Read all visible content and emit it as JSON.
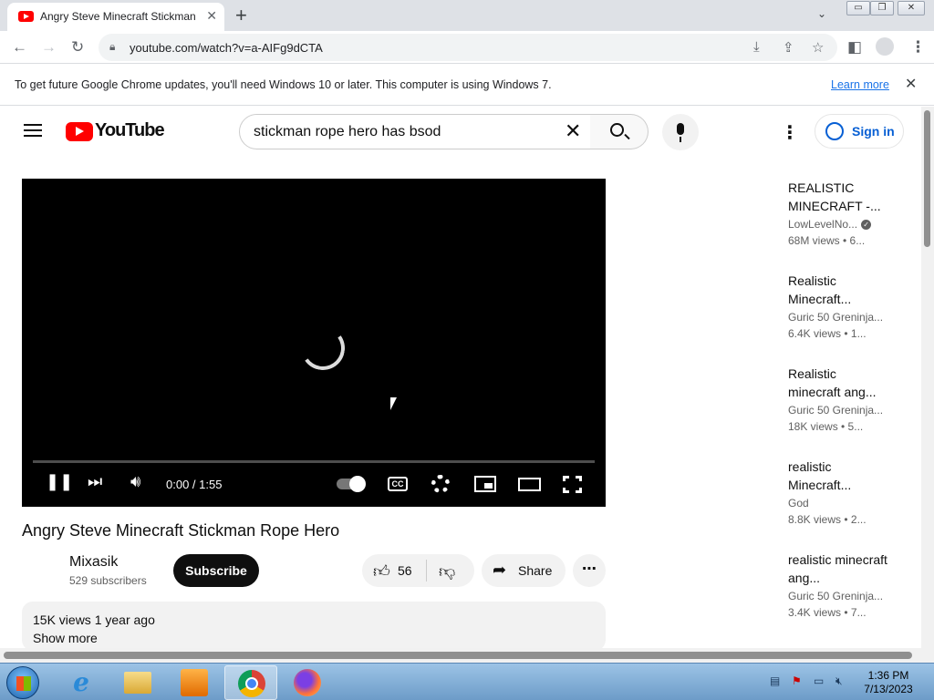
{
  "browser": {
    "tab_title": "Angry Steve Minecraft Stickman",
    "tab_close": "✕",
    "new_tab": "+",
    "tab_search": "⌄",
    "window_controls": [
      "▭",
      "❐",
      "✕"
    ],
    "url": "youtube.com/watch?v=a-AIFg9dCTA",
    "infobar_message": "To get future Google Chrome updates, you'll need Windows 10 or later. This computer is using Windows 7.",
    "infobar_link": "Learn more",
    "infobar_close": "✕"
  },
  "youtube": {
    "logo_text": "YouTube",
    "search_query": "stickman rope hero has bsod",
    "sign_in": "Sign in",
    "more_menu": "⋮"
  },
  "player": {
    "time": "0:00 / 1:55",
    "cc_label": "CC",
    "progress": 0
  },
  "video": {
    "title": "Angry Steve Minecraft Stickman Rope Hero",
    "channel": "Mixasik",
    "subscribers": "529 subscribers",
    "subscribe_label": "Subscribe",
    "likes": "56",
    "share_label": "Share",
    "meta": "15K views  1 year ago",
    "show_more": "Show more"
  },
  "recommendations": [
    {
      "title": "REALISTIC MINECRAFT -...",
      "channel": "LowLevelNo...",
      "verified": true,
      "stats": "68M views  • 6..."
    },
    {
      "title": "Realistic Minecraft...",
      "channel": "Guric 50 Greninja...",
      "verified": false,
      "stats": "6.4K views  • 1..."
    },
    {
      "title": "Realistic minecraft ang...",
      "channel": "Guric 50 Greninja...",
      "verified": false,
      "stats": "18K views  • 5..."
    },
    {
      "title": "realistic Minecraft...",
      "channel": "God",
      "verified": false,
      "stats": "8.8K views  • 2..."
    },
    {
      "title": "realistic minecraft ang...",
      "channel": "Guric 50 Greninja...",
      "verified": false,
      "stats": "3.4K views  • 7..."
    }
  ],
  "taskbar": {
    "time": "1:36 PM",
    "date": "7/13/2023"
  },
  "colors": {
    "youtube_red": "#ff0000",
    "link_blue": "#065fd4",
    "chrome_blue": "#1a73e8"
  }
}
